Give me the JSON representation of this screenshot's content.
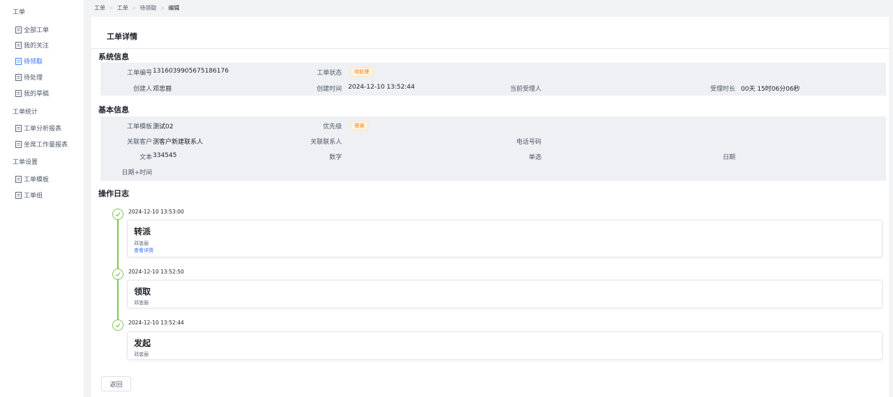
{
  "sidebar": {
    "groups": [
      {
        "label": "工单"
      },
      {
        "label": "工单统计"
      },
      {
        "label": "工单设置"
      }
    ],
    "items": [
      {
        "label": "全部工单"
      },
      {
        "label": "我的关注"
      },
      {
        "label": "待领取"
      },
      {
        "label": "待处理"
      },
      {
        "label": "我的草稿"
      },
      {
        "label": "工单分析报表"
      },
      {
        "label": "坐席工作量报表"
      },
      {
        "label": "工单模板"
      },
      {
        "label": "工单组"
      }
    ]
  },
  "breadcrumb": [
    "工单",
    "工单",
    "待领取",
    "编辑"
  ],
  "page": {
    "title": "工单详情",
    "back_label": "返回"
  },
  "system_info": {
    "title": "系统信息",
    "ticket_no_label": "工单编号",
    "ticket_no": "1316039905675186176",
    "status_label": "工单状态",
    "status": "待处理",
    "creator_label": "创建人",
    "creator": "邓忠丽",
    "created_at_label": "创建时间",
    "created_at": "2024-12-10 13:52:44",
    "assignee_label": "当前受理人",
    "assignee": "",
    "duration_label": "受理时长",
    "duration": "00天 15时06分06秒"
  },
  "basic_info": {
    "title": "基本信息",
    "template_label": "工单模板",
    "template": "测试02",
    "priority_label": "优先级",
    "priority": "普通",
    "customer_label": "关联客户",
    "customer": "测客户新建联系人",
    "contact_label": "关联联系人",
    "contact": "",
    "phone_label": "电话号码",
    "phone": "",
    "text_label": "文本",
    "text": "334545",
    "number_label": "数字",
    "number": "",
    "single_label": "单选",
    "single": "",
    "date_label": "日期",
    "date": "",
    "datetime_label": "日期+时间",
    "datetime": ""
  },
  "log": {
    "title": "操作日志",
    "entries": [
      {
        "time": "2024-12-10 13:53:00",
        "action": "转派",
        "user": "邓忠丽",
        "link": "查看详情"
      },
      {
        "time": "2024-12-10 13:52:50",
        "action": "领取",
        "user": "邓忠丽"
      },
      {
        "time": "2024-12-10 13:52:44",
        "action": "发起",
        "user": "邓忠丽"
      }
    ]
  },
  "colors": {
    "accent": "#3370ff",
    "timeline": "#7fc454",
    "status_tag": "#ff7d00"
  }
}
